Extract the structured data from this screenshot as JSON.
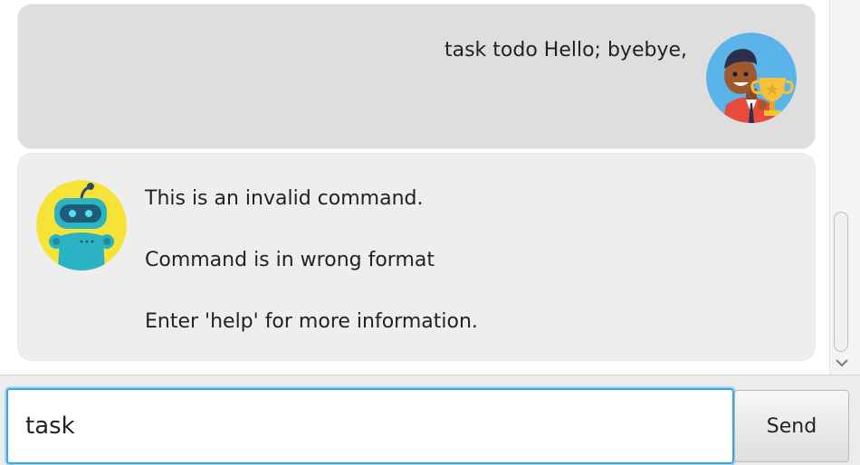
{
  "colors": {
    "user_bubble": "#dedede",
    "bot_bubble": "#eeeeee",
    "input_focus": "#3aa7dc"
  },
  "messages": {
    "user": {
      "text": "task todo Hello; byebye,",
      "avatar": "user-avatar-icon"
    },
    "bot": {
      "lines": [
        "This is an invalid command.",
        "Command is in wrong format",
        "Enter 'help' for more information."
      ],
      "avatar": "robot-avatar-icon"
    }
  },
  "input": {
    "value": "task"
  },
  "send_button": {
    "label": "Send"
  },
  "scrollbar": {
    "down_arrow_icon": "chevron-down-icon"
  }
}
